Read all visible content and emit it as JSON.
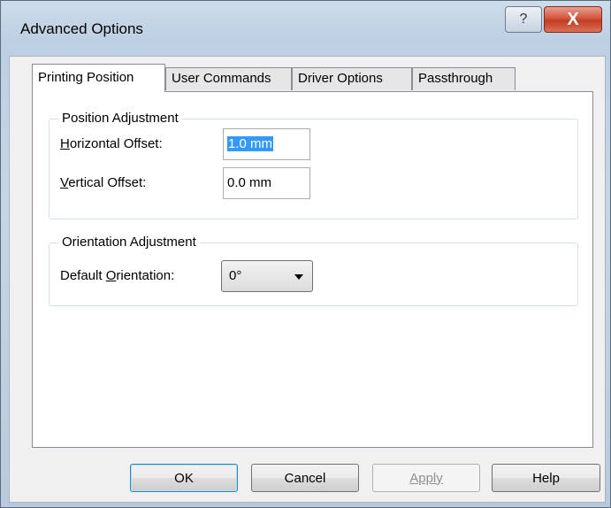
{
  "window": {
    "title": "Advanced Options",
    "help_glyph": "?",
    "close_glyph": "X"
  },
  "tabs": [
    {
      "label": "Printing Position",
      "active": true
    },
    {
      "label": "User Commands",
      "active": false
    },
    {
      "label": "Driver Options",
      "active": false
    },
    {
      "label": "Passthrough",
      "active": false
    }
  ],
  "position_group": {
    "title": "Position Adjustment",
    "horizontal_label_key": "H",
    "horizontal_label_rest": "orizontal Offset:",
    "horizontal_value": "1.0 mm",
    "vertical_label_key": "V",
    "vertical_label_rest": "ertical Offset:",
    "vertical_value": "0.0 mm"
  },
  "orientation_group": {
    "title": "Orientation Adjustment",
    "default_label_pre": "Default ",
    "default_label_key": "O",
    "default_label_rest": "rientation:",
    "selected_value": "0°"
  },
  "buttons": {
    "ok": "OK",
    "cancel": "Cancel",
    "apply": "Apply",
    "help": "Help"
  }
}
